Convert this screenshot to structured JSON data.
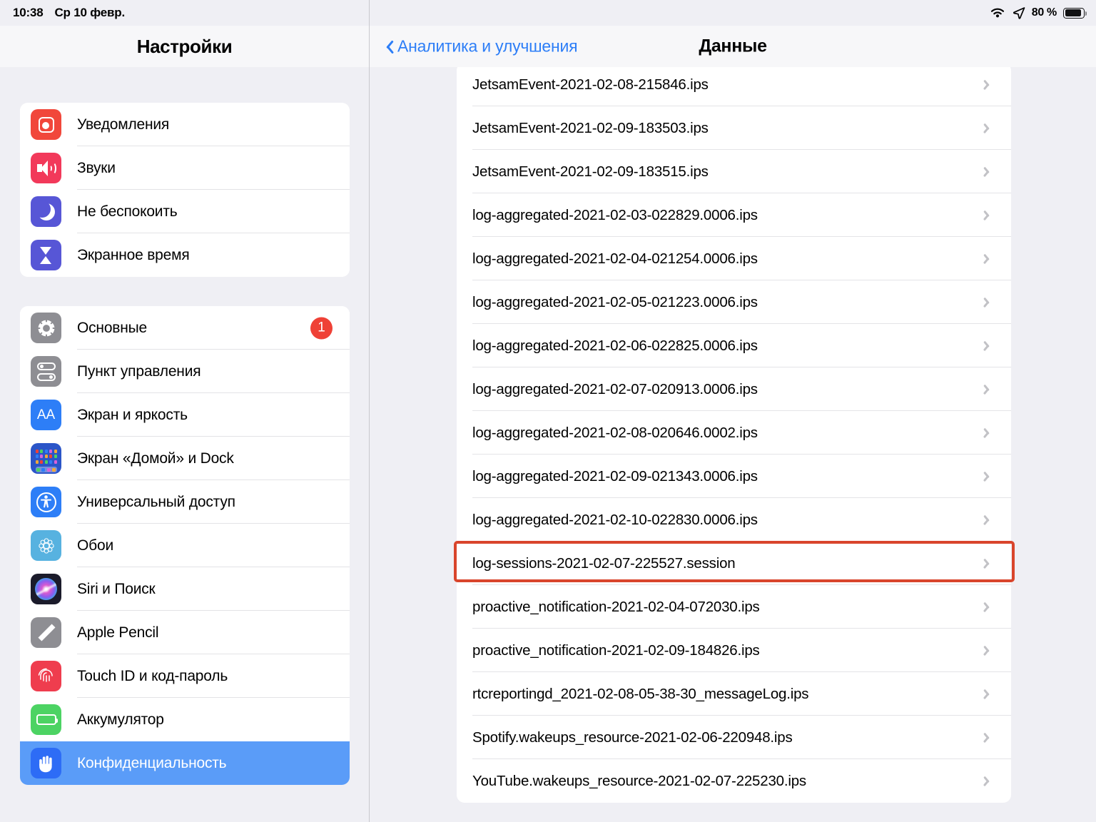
{
  "status_bar": {
    "time": "10:38",
    "date": "Ср 10 февр.",
    "battery_percent": "80 %",
    "wifi_icon": "wifi-icon",
    "location_icon": "location-arrow-icon",
    "battery_icon": "battery-icon",
    "battery_level": 80
  },
  "sidebar": {
    "title": "Настройки",
    "groups": [
      {
        "items": [
          {
            "label": "Уведомления",
            "icon": "notifications-icon",
            "icon_color": "#f1473b",
            "badge": null,
            "selected": false
          },
          {
            "label": "Звуки",
            "icon": "speaker-icon",
            "icon_color": "#f2395a",
            "badge": null,
            "selected": false
          },
          {
            "label": "Не беспокоить",
            "icon": "moon-icon",
            "icon_color": "#5756d6",
            "badge": null,
            "selected": false
          },
          {
            "label": "Экранное время",
            "icon": "hourglass-icon",
            "icon_color": "#5756d6",
            "badge": null,
            "selected": false
          }
        ]
      },
      {
        "items": [
          {
            "label": "Основные",
            "icon": "gear-icon",
            "icon_color": "#8e8e93",
            "badge": "1",
            "selected": false
          },
          {
            "label": "Пункт управления",
            "icon": "control-center-icon",
            "icon_color": "#8e8e93",
            "badge": null,
            "selected": false
          },
          {
            "label": "Экран и яркость",
            "icon": "display-brightness-icon",
            "icon_color": "#2d7ef7",
            "badge": null,
            "selected": false
          },
          {
            "label": "Экран «Домой» и Dock",
            "icon": "home-screen-dock-icon",
            "icon_color": "#2b55c8",
            "badge": null,
            "selected": false
          },
          {
            "label": "Универсальный доступ",
            "icon": "accessibility-icon",
            "icon_color": "#2d7ef7",
            "badge": null,
            "selected": false
          },
          {
            "label": "Обои",
            "icon": "wallpaper-flower-icon",
            "icon_color": "#57b2e0",
            "badge": null,
            "selected": false
          },
          {
            "label": "Siri и Поиск",
            "icon": "siri-icon",
            "icon_color": "#1b1b2b",
            "badge": null,
            "selected": false
          },
          {
            "label": "Apple Pencil",
            "icon": "pencil-icon",
            "icon_color": "#8e8e93",
            "badge": null,
            "selected": false
          },
          {
            "label": "Touch ID и код-пароль",
            "icon": "touch-id-icon",
            "icon_color": "#ef3d4e",
            "badge": null,
            "selected": false
          },
          {
            "label": "Аккумулятор",
            "icon": "battery-icon",
            "icon_color": "#4cd363",
            "badge": null,
            "selected": false
          },
          {
            "label": "Конфиденциальность",
            "icon": "hand-privacy-icon",
            "icon_color": "#2d6cf6",
            "badge": null,
            "selected": true
          }
        ]
      }
    ],
    "selection_color": "#5a9cf8",
    "badge_color": "#ef4136"
  },
  "detail": {
    "back_label": "Аналитика и улучшения",
    "back_icon": "chevron-left-icon",
    "title": "Данные",
    "row_chevron_icon": "chevron-right-icon",
    "annotation": {
      "highlight_color": "#d9452c",
      "highlighted_row_index": 11
    },
    "rows": [
      {
        "name": "JetsamEvent-2021-02-08-215846.ips"
      },
      {
        "name": "JetsamEvent-2021-02-09-183503.ips"
      },
      {
        "name": "JetsamEvent-2021-02-09-183515.ips"
      },
      {
        "name": "log-aggregated-2021-02-03-022829.0006.ips"
      },
      {
        "name": "log-aggregated-2021-02-04-021254.0006.ips"
      },
      {
        "name": "log-aggregated-2021-02-05-021223.0006.ips"
      },
      {
        "name": "log-aggregated-2021-02-06-022825.0006.ips"
      },
      {
        "name": "log-aggregated-2021-02-07-020913.0006.ips"
      },
      {
        "name": "log-aggregated-2021-02-08-020646.0002.ips"
      },
      {
        "name": "log-aggregated-2021-02-09-021343.0006.ips"
      },
      {
        "name": "log-aggregated-2021-02-10-022830.0006.ips"
      },
      {
        "name": "log-sessions-2021-02-07-225527.session"
      },
      {
        "name": "proactive_notification-2021-02-04-072030.ips"
      },
      {
        "name": "proactive_notification-2021-02-09-184826.ips"
      },
      {
        "name": "rtcreportingd_2021-02-08-05-38-30_messageLog.ips"
      },
      {
        "name": "Spotify.wakeups_resource-2021-02-06-220948.ips"
      },
      {
        "name": "YouTube.wakeups_resource-2021-02-07-225230.ips"
      }
    ]
  }
}
